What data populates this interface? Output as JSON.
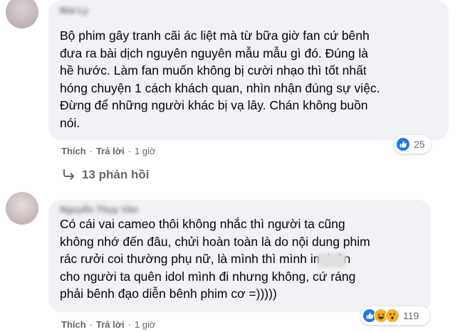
{
  "comments": [
    {
      "author": "Mai Ly",
      "text": "Bộ phim gây tranh cãi ác liệt mà từ bữa giờ fan cứ bênh\nđưa ra bài dịch nguyên nguyên mẫu mẫu gì đó. Đúng là\nhề hước. Làm fan muốn không bị cười nhạo thì tốt nhất\nhóng chuyện 1 cách khách quan, nhìn nhận đúng sự việc.\nĐừng để những người khác bị vạ lây. Chán không buồn\nnói.",
      "reaction_count": "25",
      "reactions": [
        "like-icon"
      ],
      "like_label": "Thích",
      "reply_label": "Trả lời",
      "time": "1 giờ",
      "replies_label": "13 phản hồi"
    },
    {
      "author": "Nguyễn Thụy Vân",
      "text": "Có cái vai cameo thôi không nhắc thì người ta cũng\nkhông nhớ đến đâu, chửi hoàn toàn là do nội dung phim\nrác rưởi coi thường phụ nữ, là mình thì mình im      luôn\ncho người ta quên idol mình đi nhưng không, cứ ráng\nphải bênh đạo diễn bênh phim cơ =)))))",
      "reaction_count": "119",
      "reactions": [
        "like-icon",
        "haha-icon",
        "wow-icon"
      ],
      "like_label": "Thích",
      "reply_label": "Trả lời",
      "time": "1 giờ"
    }
  ],
  "colors": {
    "bubble": "#f0f2f5",
    "like_blue": "#1877f2",
    "secondary_text": "#65676b",
    "emoji_yellow": "#f7b125"
  }
}
